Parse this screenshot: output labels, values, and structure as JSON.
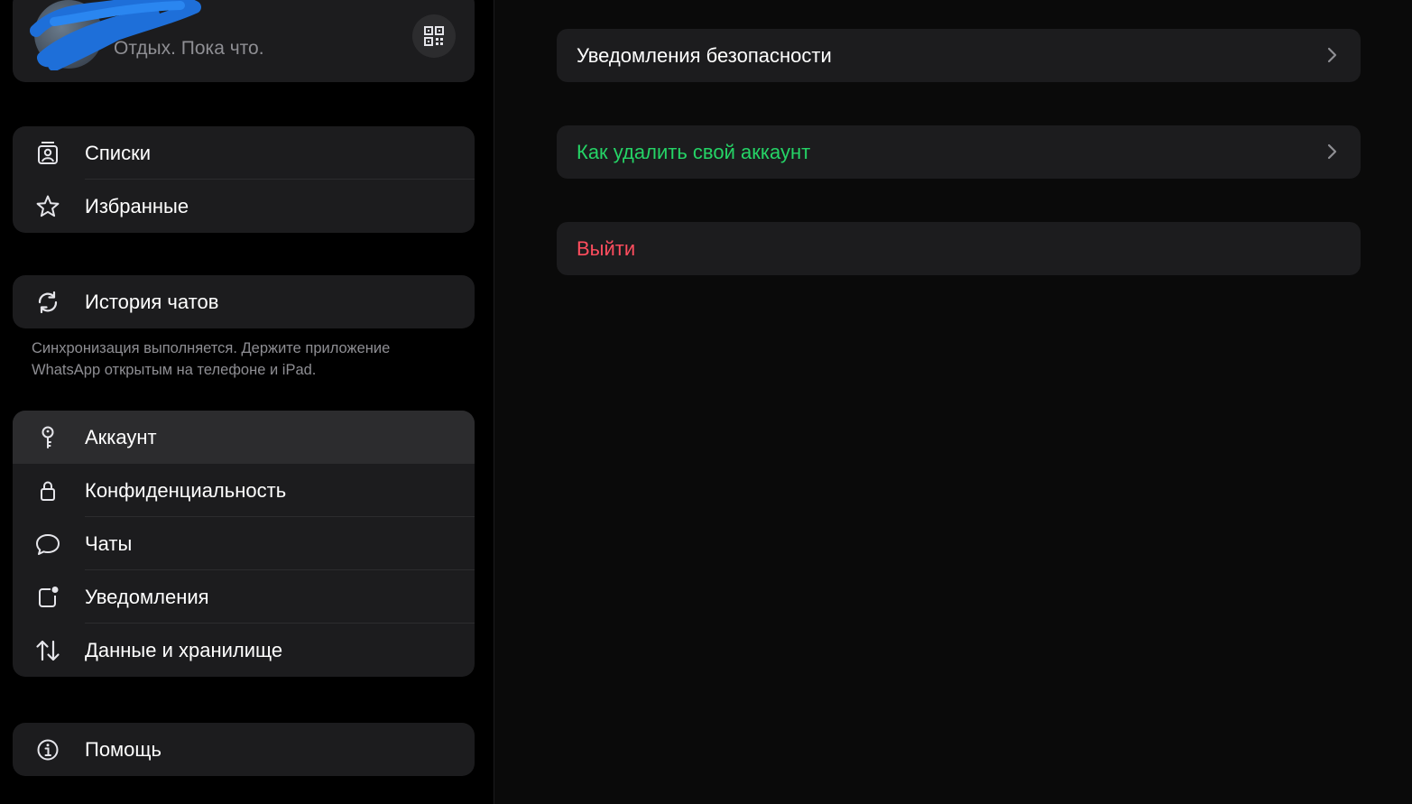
{
  "profile": {
    "status": "Отдых. Пока что.",
    "qr_icon": "qr-code-icon"
  },
  "sidebar": {
    "group1": [
      {
        "label": "Списки",
        "icon": "lists-icon"
      },
      {
        "label": "Избранные",
        "icon": "star-icon"
      }
    ],
    "chat_history": {
      "label": "История чатов",
      "icon": "sync-icon"
    },
    "sync_note": "Синхронизация выполняется. Держите приложение WhatsApp открытым на телефоне и iPad.",
    "settings": [
      {
        "label": "Аккаунт",
        "icon": "key-icon",
        "selected": true
      },
      {
        "label": "Конфиденциальность",
        "icon": "lock-icon"
      },
      {
        "label": "Чаты",
        "icon": "chat-bubble-icon"
      },
      {
        "label": "Уведомления",
        "icon": "notification-icon"
      },
      {
        "label": "Данные и хранилище",
        "icon": "data-transfer-icon"
      }
    ],
    "help": {
      "label": "Помощь",
      "icon": "info-icon"
    }
  },
  "main": {
    "security_notifications": "Уведомления безопасности",
    "delete_account": "Как удалить свой аккаунт",
    "logout": "Выйти"
  },
  "colors": {
    "background": "#000000",
    "card": "#1c1c1e",
    "selected": "#2c2c2e",
    "accent_green": "#25d366",
    "danger_red": "#ff4d5e",
    "secondary_text": "#8e8e93"
  }
}
